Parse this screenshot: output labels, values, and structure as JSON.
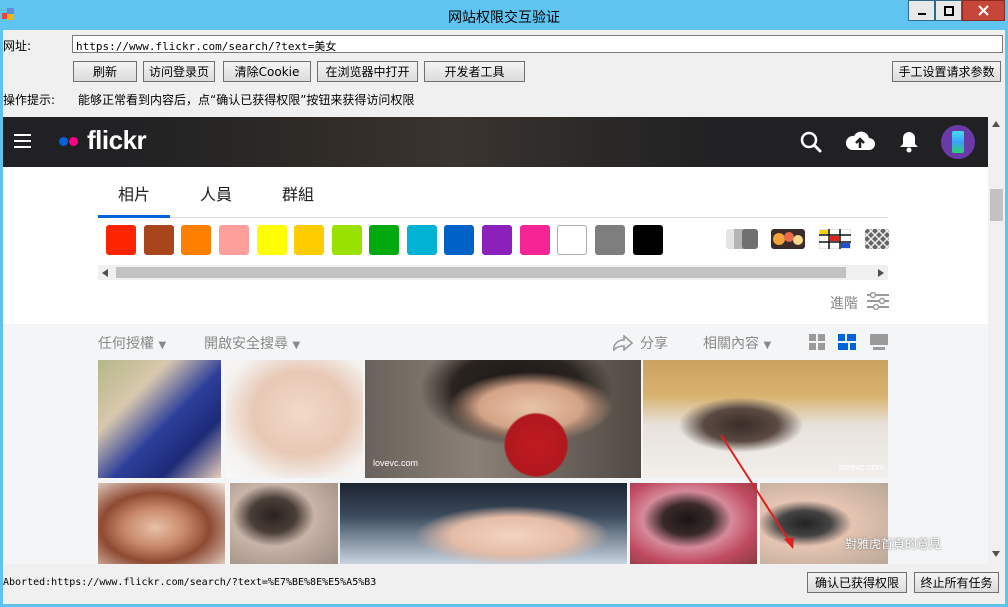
{
  "window": {
    "title": "网站权限交互验证"
  },
  "address": {
    "label": "网址:",
    "value": "https://www.flickr.com/search/?text=美女"
  },
  "toolbar": {
    "refresh": "刷新",
    "visit_login": "访问登录页",
    "clear_cookie": "清除Cookie",
    "open_browser": "在浏览器中打开",
    "devtools": "开发者工具",
    "manual_headers": "手工设置请求参数"
  },
  "hint": {
    "label": "操作提示:",
    "text": "能够正常看到内容后，点“确认已获得权限”按钮来获得访问权限"
  },
  "flickr": {
    "logo": "flickr",
    "tabs": [
      "相片",
      "人員",
      "群組"
    ],
    "colors": [
      "#ff2500",
      "#a8451b",
      "#ff7f00",
      "#ff9f9c",
      "#ffff00",
      "#ffcc00",
      "#99e100",
      "#00a90d",
      "#00b2d4",
      "#0062c6",
      "#8c20ba",
      "#f52394",
      "#ffffff",
      "#7e7e7e",
      "#000000"
    ],
    "advanced": "進階",
    "filters": {
      "license": "任何授權",
      "safe_search": "開啟安全搜尋",
      "share": "分享",
      "relevance": "相關內容"
    },
    "watermarks": [
      "lovevc.com",
      "lovevc.com"
    ],
    "feedback": "對雅虎首頁的意見"
  },
  "status": {
    "text": "Aborted:https://www.flickr.com/search/?text=%E7%BE%8E%E5%A5%B3",
    "confirm": "确认已获得权限",
    "stop": "终止所有任务"
  }
}
